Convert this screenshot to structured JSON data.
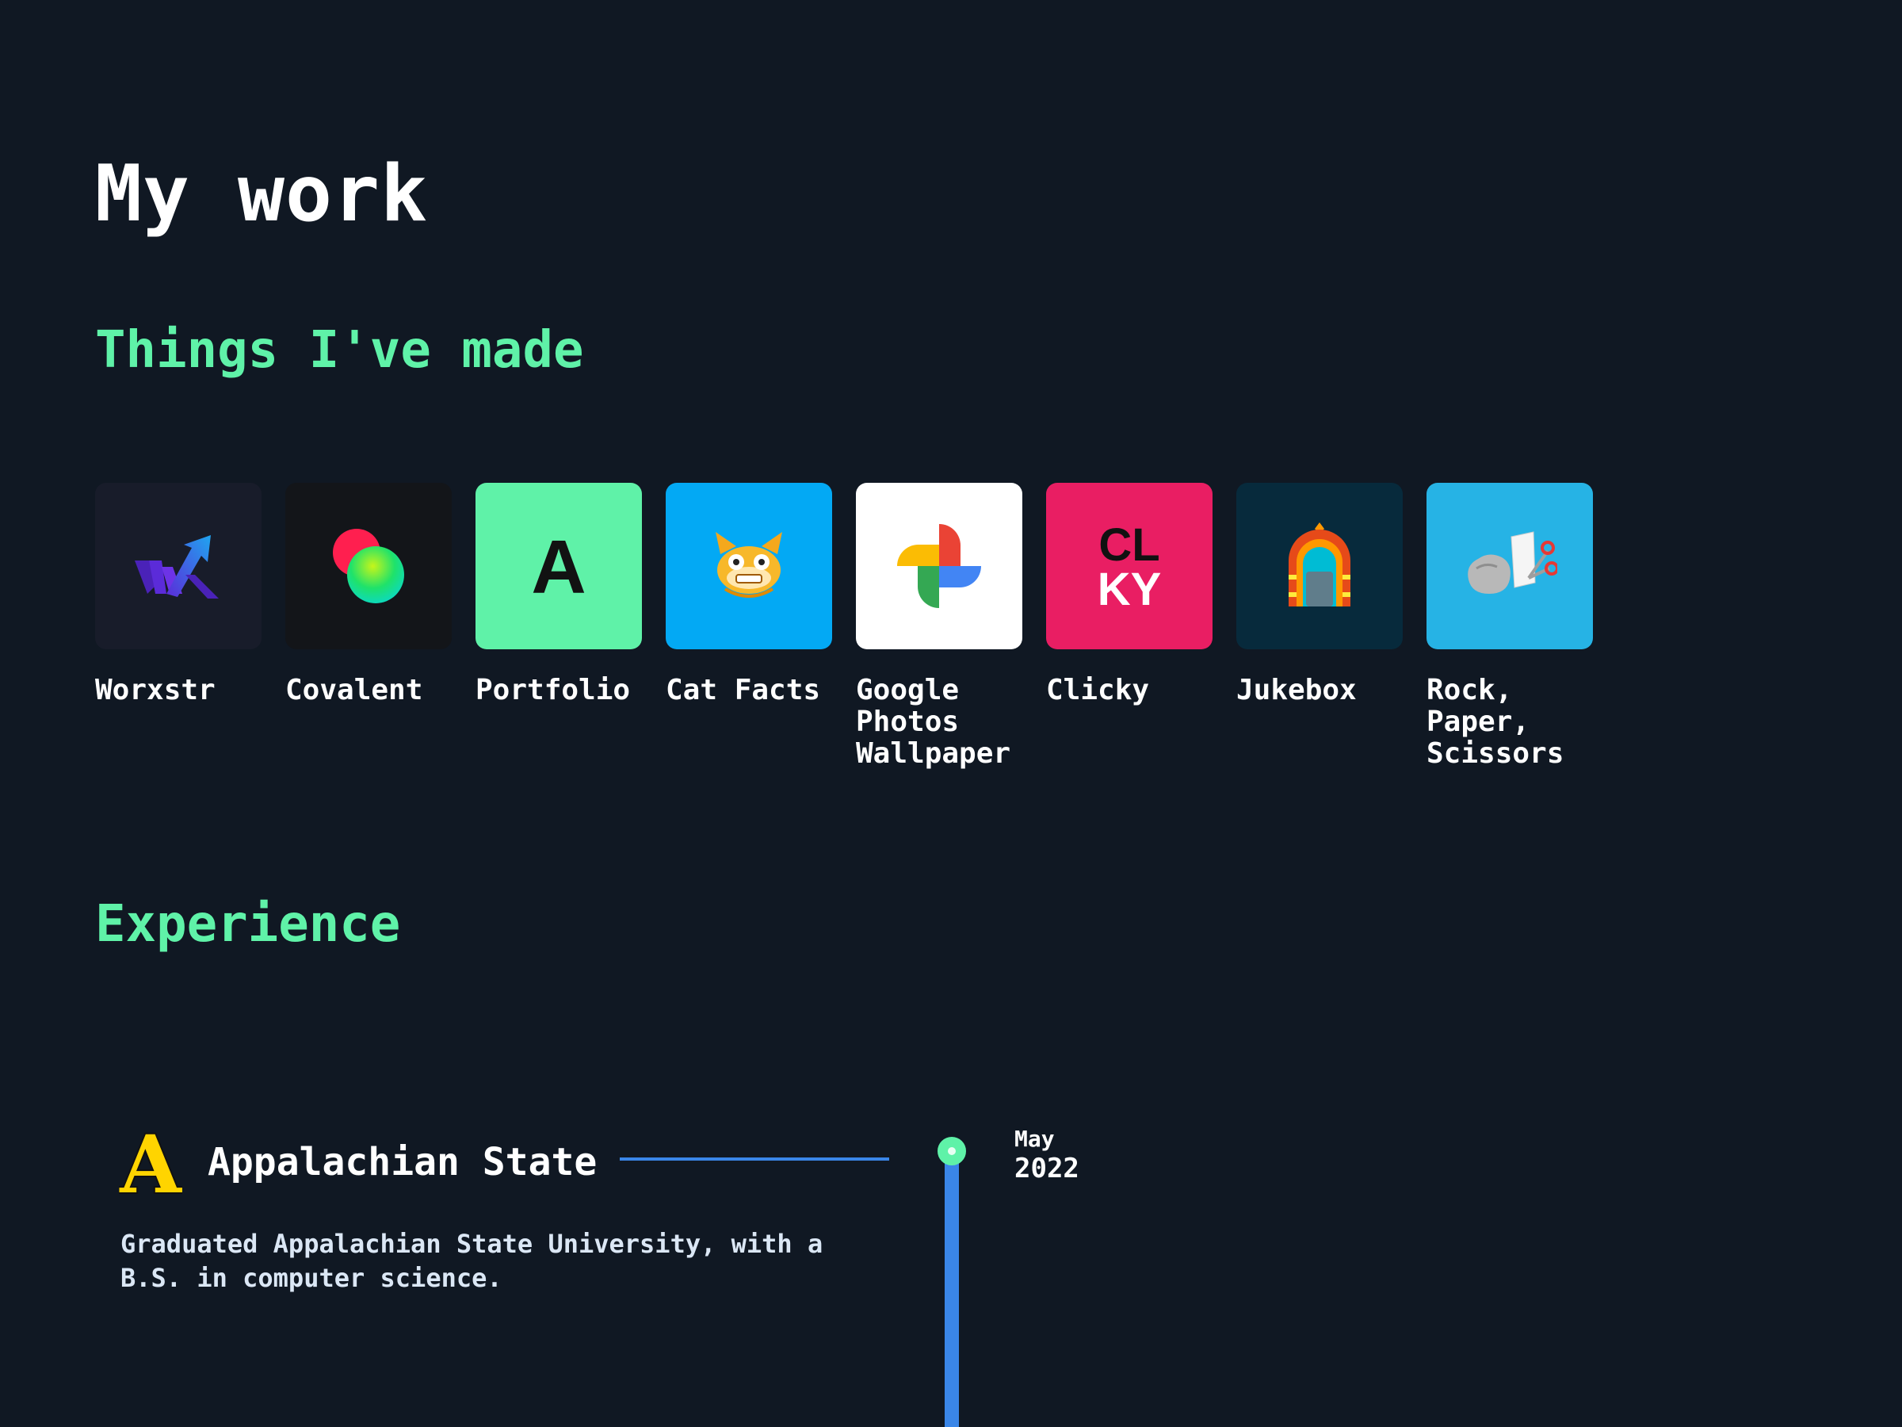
{
  "page": {
    "title": "My work"
  },
  "sections": {
    "made": {
      "heading": "Things I've made"
    },
    "experience": {
      "heading": "Experience"
    }
  },
  "projects": [
    {
      "name": "Worxstr",
      "icon": "worxstr-logo-icon",
      "bg": "#181c2a"
    },
    {
      "name": "Covalent",
      "icon": "covalent-logo-icon",
      "bg": "#131519"
    },
    {
      "name": "Portfolio",
      "icon": "portfolio-letter-a-icon",
      "letter": "A",
      "bg": "#5ff2a8"
    },
    {
      "name": "Cat Facts",
      "icon": "cat-face-icon",
      "bg": "#03a9f4"
    },
    {
      "name": "Google Photos Wallpaper",
      "icon": "google-photos-pinwheel-icon",
      "bg": "#ffffff"
    },
    {
      "name": "Clicky",
      "icon": "clicky-logo-icon",
      "logo_text": [
        "CL",
        "KY"
      ],
      "bg": "#e91e63"
    },
    {
      "name": "Jukebox",
      "icon": "jukebox-icon",
      "bg": "#072a3c"
    },
    {
      "name": "Rock, Paper, Scissors",
      "icon": "rock-paper-scissors-icon",
      "bg": "#26b3e5"
    }
  ],
  "experience": [
    {
      "name": "Appalachian State",
      "logo": "appalachian-state-a-logo",
      "logo_text": "A",
      "description": "Graduated Appalachian State University, with a B.S. in computer science.",
      "date": {
        "month": "May",
        "year": "2022"
      }
    }
  ],
  "colors": {
    "background": "#101823",
    "accent": "#5ff2a8",
    "timeline": "#3a86e8"
  }
}
